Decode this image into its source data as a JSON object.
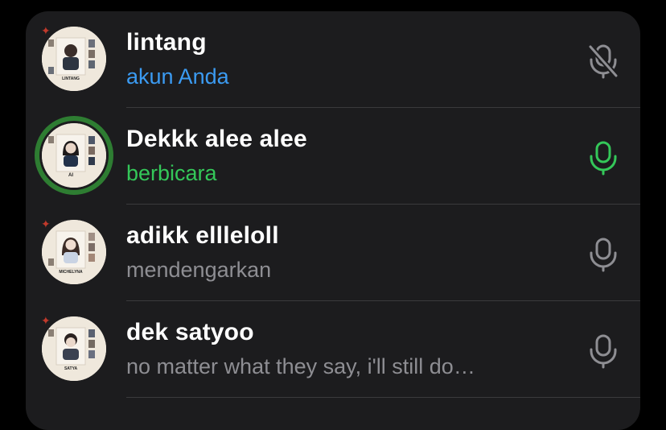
{
  "colors": {
    "background": "#000000",
    "panel": "#1c1c1e",
    "divider": "#3a3a3c",
    "name": "#ffffff",
    "self_status": "#3b9bf2",
    "speaking_status": "#34c759",
    "listening_status": "#8e8e93",
    "speaking_ring": "#2e7d32",
    "mic_muted": "#8e8e93",
    "mic_active": "#34c759",
    "mic_idle": "#8e8e93"
  },
  "participants": [
    {
      "name": "lintang",
      "status": "akun Anda",
      "status_kind": "self",
      "avatar_caption": "LINTANG",
      "mic_icon": "mic-muted-icon",
      "speaking": false
    },
    {
      "name": "Dekkk alee alee",
      "status": "berbicara",
      "status_kind": "speaking",
      "avatar_caption": "AI",
      "mic_icon": "mic-active-icon",
      "speaking": true
    },
    {
      "name": "adikk ellleloll",
      "status": "mendengarkan",
      "status_kind": "listening",
      "avatar_caption": "MICHELYNA",
      "mic_icon": "mic-icon",
      "speaking": false
    },
    {
      "name": "dek satyoo",
      "status": "no matter what they say, i'll still do…",
      "status_kind": "listening",
      "avatar_caption": "SATYA",
      "mic_icon": "mic-icon",
      "speaking": false
    }
  ]
}
